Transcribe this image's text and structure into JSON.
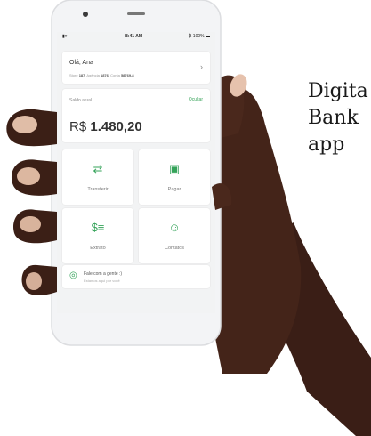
{
  "caption": [
    "Digita",
    "Bank",
    "app"
  ],
  "status": {
    "signal": "▮▾",
    "time": "8:41 AM",
    "battery": "₿ 100% ▬"
  },
  "account": {
    "name": "Olá, Ana",
    "store_label": "Store",
    "store_value": "187",
    "agency_label": "Agência",
    "agency_value": "1876",
    "conta_label": "Conta",
    "conta_value": "58769-8",
    "chevron": "›"
  },
  "balance": {
    "label": "Saldo atual",
    "hide": "Ocultar",
    "currency": "R$",
    "amount": "1.480,20"
  },
  "tiles": [
    {
      "icon": "⇄",
      "label": "Transferir"
    },
    {
      "icon": "▣",
      "label": "Pagar"
    },
    {
      "icon": "$≡",
      "label": "Extrato"
    },
    {
      "icon": "☺",
      "label": "Contatos"
    }
  ],
  "chat": {
    "icon": "◎",
    "title": "Fale com a gente :)",
    "subtitle": "Estamos aqui por você"
  },
  "colors": {
    "accent": "#35a35a",
    "skin": "#3d2018"
  }
}
